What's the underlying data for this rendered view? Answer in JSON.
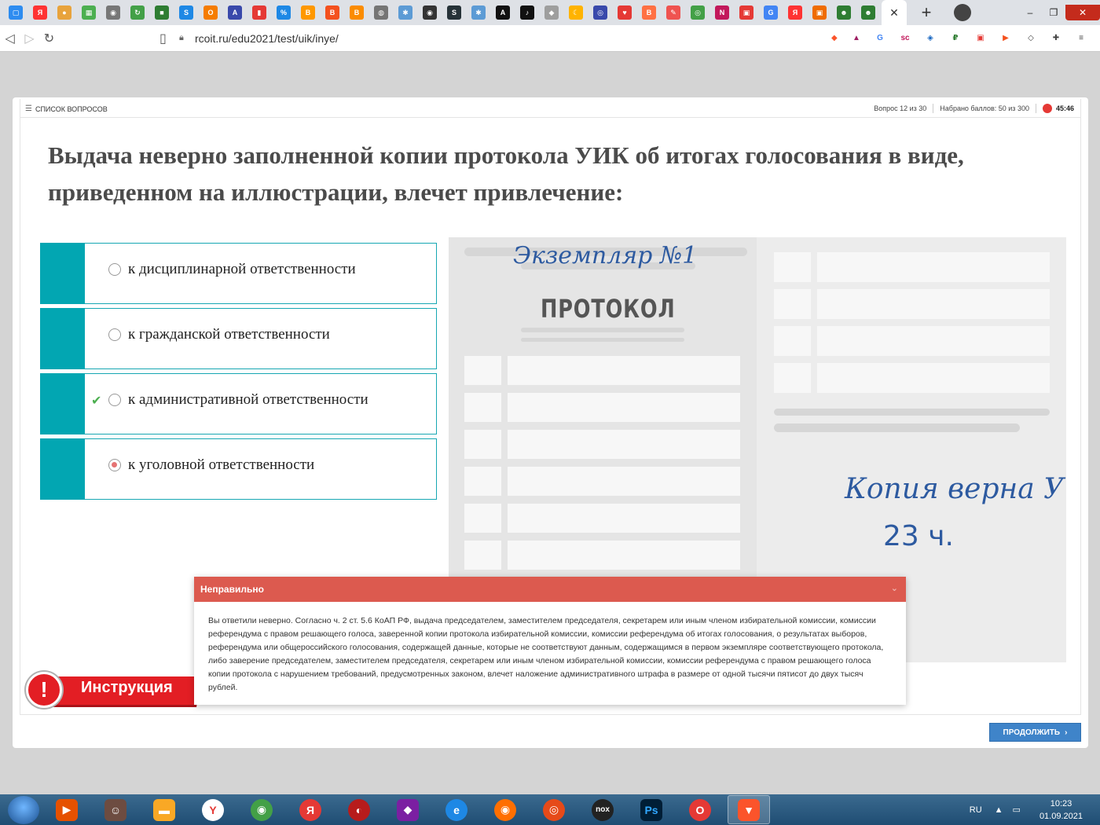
{
  "browser": {
    "tabs_icons": [
      {
        "name": "chat",
        "color": "#2d8cf0",
        "glyph": "▢"
      },
      {
        "name": "yandex",
        "color": "#ff3333",
        "glyph": "Я"
      },
      {
        "name": "ball",
        "color": "#e8a33c",
        "glyph": "●"
      },
      {
        "name": "apps",
        "color": "#4caf50",
        "glyph": "▦"
      },
      {
        "name": "eye",
        "color": "#777777",
        "glyph": "◉"
      },
      {
        "name": "sync",
        "color": "#43a047",
        "glyph": "↻"
      },
      {
        "name": "evernote",
        "color": "#2e7d32",
        "glyph": "■"
      },
      {
        "name": "serf",
        "color": "#1e88e5",
        "glyph": "S"
      },
      {
        "name": "onlysurf",
        "color": "#f57c00",
        "glyph": "O"
      },
      {
        "name": "chart",
        "color": "#3949ab",
        "glyph": "A"
      },
      {
        "name": "bars",
        "color": "#e53935",
        "glyph": "▮"
      },
      {
        "name": "link",
        "color": "#1e88e5",
        "glyph": "%"
      },
      {
        "name": "blogger1",
        "color": "#ff9800",
        "glyph": "B"
      },
      {
        "name": "blogger2",
        "color": "#f4511e",
        "glyph": "B"
      },
      {
        "name": "blogger3",
        "color": "#fb8c00",
        "glyph": "B"
      },
      {
        "name": "globe",
        "color": "#757575",
        "glyph": "◍"
      },
      {
        "name": "snow",
        "color": "#5c9bd5",
        "glyph": "✱"
      },
      {
        "name": "eye2",
        "color": "#333333",
        "glyph": "◉"
      },
      {
        "name": "seo",
        "color": "#263238",
        "glyph": "S"
      },
      {
        "name": "snow2",
        "color": "#5c9bd5",
        "glyph": "✱"
      },
      {
        "name": "a",
        "color": "#111111",
        "glyph": "A"
      },
      {
        "name": "tiktok",
        "color": "#111111",
        "glyph": "♪"
      },
      {
        "name": "cube",
        "color": "#9e9e9e",
        "glyph": "◆"
      },
      {
        "name": "moon",
        "color": "#ffb300",
        "glyph": "☾"
      },
      {
        "name": "circle",
        "color": "#3949ab",
        "glyph": "◎"
      },
      {
        "name": "heart",
        "color": "#e53935",
        "glyph": "♥"
      },
      {
        "name": "blogger4",
        "color": "#ff7043",
        "glyph": "B"
      },
      {
        "name": "note",
        "color": "#ef5350",
        "glyph": "✎"
      },
      {
        "name": "ring",
        "color": "#43a047",
        "glyph": "◎"
      },
      {
        "name": "n",
        "color": "#c2185b",
        "glyph": "N"
      },
      {
        "name": "box",
        "color": "#e53935",
        "glyph": "▣"
      },
      {
        "name": "google",
        "color": "#4285f4",
        "glyph": "G"
      },
      {
        "name": "yandex2",
        "color": "#ff3333",
        "glyph": "Я"
      },
      {
        "name": "frame",
        "color": "#ef6c00",
        "glyph": "▣"
      },
      {
        "name": "people1",
        "color": "#2e7d32",
        "glyph": "☻"
      },
      {
        "name": "people2",
        "color": "#2e7d32",
        "glyph": "☻"
      }
    ],
    "url": "rcoit.ru/edu2021/test/uik/inye/"
  },
  "quiz": {
    "question_list_label": "Список вопросов",
    "progress": "Вопрос 12 из 30",
    "score": "Набрано баллов: 50 из 300",
    "timer": "45:46",
    "question": "Выдача неверно заполненной копии протокола УИК об итогах голосования в виде, приведенном на иллюстрации, влечет привлечение:",
    "answers": [
      {
        "label": "к дисциплинарной ответственности",
        "selected": false,
        "correct": false
      },
      {
        "label": "к гражданской ответственности",
        "selected": false,
        "correct": false
      },
      {
        "label": "к административной ответственности",
        "selected": false,
        "correct": true
      },
      {
        "label": "к уголовной ответственности",
        "selected": true,
        "correct": false
      }
    ],
    "illustration": {
      "copy_label": "Экземпляр №1",
      "title": "ПРОТОКОЛ",
      "verified_label": "Копия верна",
      "verified_mark": "У",
      "time_label": "23 ч."
    },
    "instruction_label": "Инструкция",
    "feedback": {
      "title": "Неправильно",
      "text": "Вы ответили неверно. Согласно ч. 2 ст. 5.6 КоАП РФ, выдача председателем, заместителем председателя, секретарем или иным членом избирательной комиссии, комиссии референдума с правом решающего голоса, заверенной копии протокола избирательной комиссии, комиссии референдума об итогах голосования, о результатах выборов, референдума или общероссийского голосования, содержащей данные, которые не соответствуют данным, содержащимся в первом экземпляре соответствующего протокола, либо заверение председателем, заместителем председателя, секретарем или иным членом избирательной комиссии, комиссии референдума с правом решающего голоса копии протокола с нарушением требований, предусмотренных законом, влечет наложение административного штрафа в размере от одной тысячи пятисот до двух тысяч рублей."
    },
    "continue_label": "Продолжить"
  },
  "taskbar": {
    "lang": "RU",
    "time": "10:23",
    "date": "01.09.2021"
  }
}
